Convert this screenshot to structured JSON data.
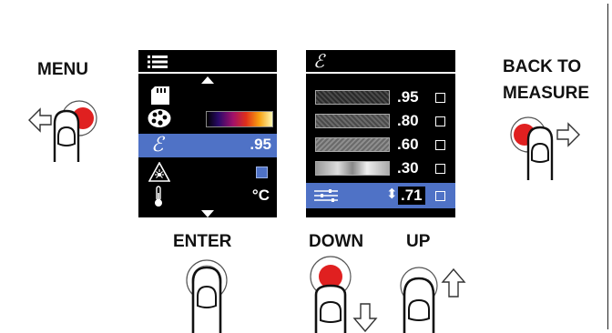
{
  "labels": {
    "menu": "MENU",
    "back_to_measure_line1": "BACK TO",
    "back_to_measure_line2": "MEASURE",
    "enter": "ENTER",
    "down": "DOWN",
    "up": "UP"
  },
  "menu_screen": {
    "emissivity_symbol": "ℰ",
    "emissivity_value": ".95",
    "temperature_unit": "°C"
  },
  "emissivity_screen": {
    "header_symbol": "ℰ",
    "presets": [
      ".95",
      ".80",
      ".60",
      ".30"
    ],
    "custom_value": ".71",
    "custom_arrows": "⬍"
  },
  "colors": {
    "highlight": "#4f72c6",
    "finger_dot": "#e02020"
  }
}
